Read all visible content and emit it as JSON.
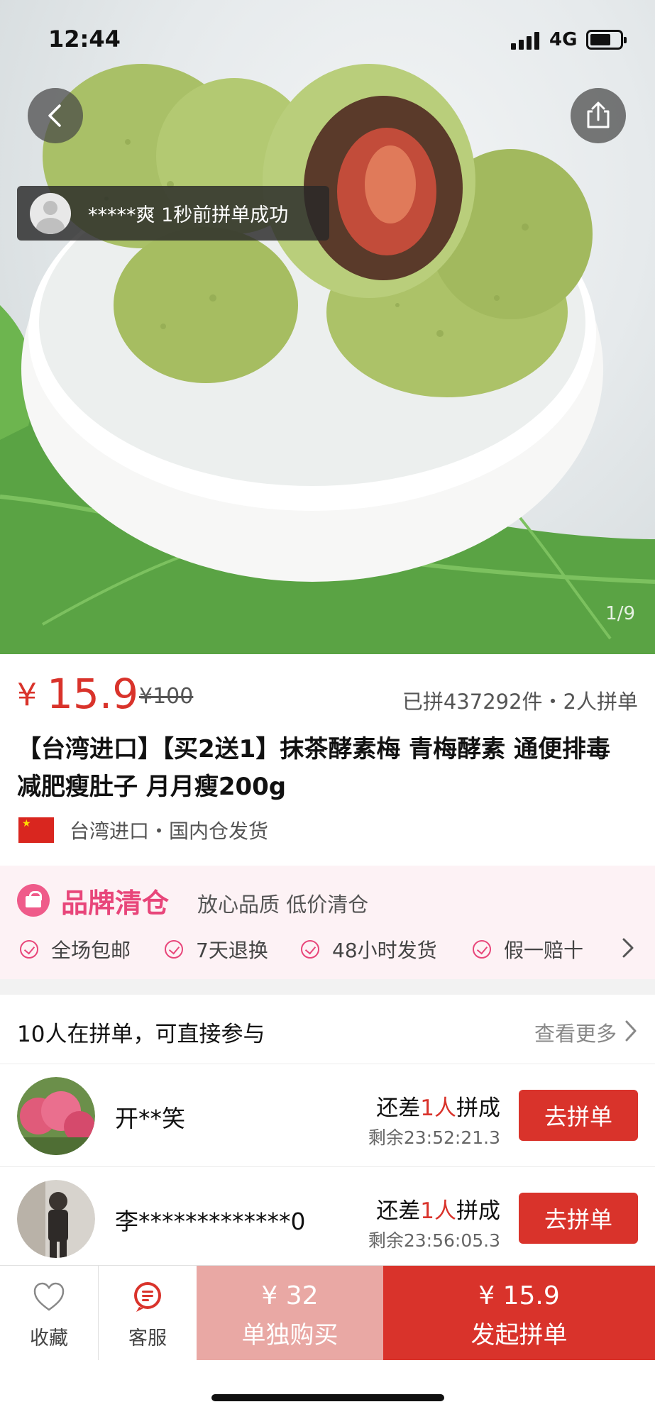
{
  "status_bar": {
    "time": "12:44",
    "network": "4G"
  },
  "gallery": {
    "counter": "1/9"
  },
  "toast": {
    "text": "*****爽  1秒前拼单成功"
  },
  "product": {
    "currency": "¥",
    "price": "15.9",
    "original_price": "¥100",
    "sold": "已拼437292件・2人拼单",
    "title": "【台湾进口】【买2送1】抹茶酵素梅 青梅酵素 通便排毒 减肥瘦肚子 月月瘦200g",
    "origin": "台湾进口・国内仓发货"
  },
  "brand": {
    "title": "品牌清仓",
    "subtitle": "放心品质 低价清仓",
    "guarantees": [
      "全场包邮",
      "7天退换",
      "48小时发货",
      "假一赔十"
    ]
  },
  "group": {
    "header": "10人在拼单，可直接参与",
    "more": "查看更多",
    "rows": [
      {
        "name": "开**笑",
        "need_prefix": "还差",
        "need_count": "1人",
        "need_suffix": "拼成",
        "remaining": "剩余23:52:21.3",
        "button": "去拼单"
      },
      {
        "name": "李*************0",
        "need_prefix": "还差",
        "need_count": "1人",
        "need_suffix": "拼成",
        "remaining": "剩余23:56:05.3",
        "button": "去拼单"
      }
    ]
  },
  "bottom_bar": {
    "favorite": "收藏",
    "service": "客服",
    "single_price": "¥ 32",
    "single_label": "单独购买",
    "group_price": "¥ 15.9",
    "group_label": "发起拼单"
  },
  "colors": {
    "accent_red": "#d9332b",
    "brand_pink": "#e8467a",
    "single_buy_bg": "#e9a8a4"
  },
  "icons": [
    "back-arrow-icon",
    "share-icon",
    "avatar-placeholder-icon",
    "china-flag-icon",
    "shopping-bag-icon",
    "check-circle-icon",
    "chevron-right-icon",
    "heart-icon",
    "chat-icon"
  ]
}
